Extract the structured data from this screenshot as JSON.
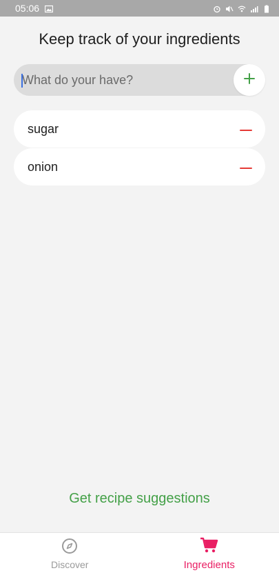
{
  "status_bar": {
    "time": "05:06",
    "icons": [
      "image-icon",
      "alarm-icon",
      "mute-icon",
      "wifi-icon",
      "signal-icon",
      "battery-icon"
    ]
  },
  "page": {
    "title": "Keep track of your ingredients"
  },
  "search": {
    "placeholder": "What do your have?",
    "value": ""
  },
  "add_button": {
    "icon": "plus-icon",
    "color": "#43a047"
  },
  "ingredients": [
    {
      "label": "sugar",
      "action_icon": "minus-icon"
    },
    {
      "label": "onion",
      "action_icon": "minus-icon"
    }
  ],
  "suggest": {
    "label": "Get recipe suggestions"
  },
  "bottom_nav": {
    "items": [
      {
        "label": "Discover",
        "icon": "compass-icon",
        "active": false
      },
      {
        "label": "Ingredients",
        "icon": "cart-icon",
        "active": true
      }
    ]
  },
  "colors": {
    "accent": "#e91e63",
    "green": "#43a047",
    "remove": "#e53935",
    "background": "#f3f3f3"
  }
}
